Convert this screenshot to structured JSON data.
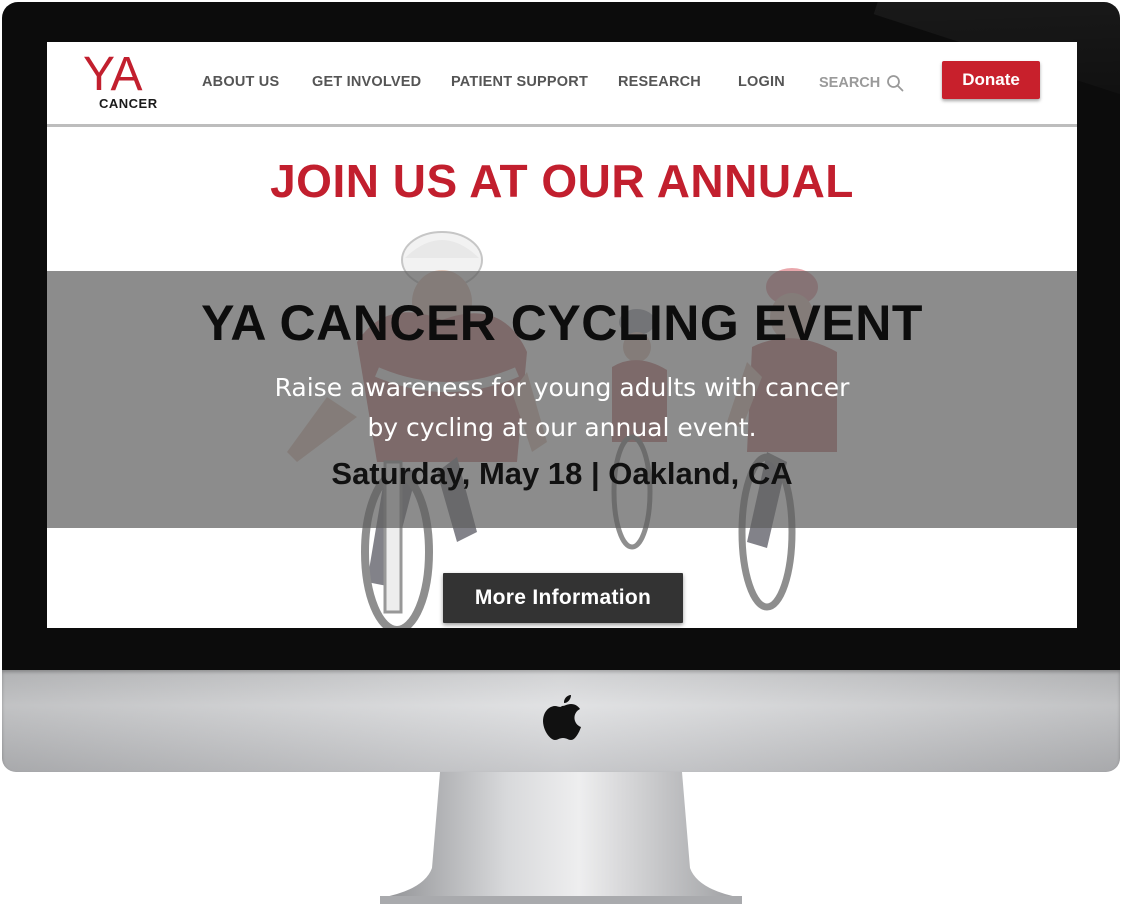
{
  "brand": {
    "logo_text": "YA",
    "logo_subtext": "CANCER",
    "accent_color": "#c21f2e"
  },
  "nav": {
    "items": [
      {
        "label": "ABOUT US"
      },
      {
        "label": "GET INVOLVED"
      },
      {
        "label": "PATIENT SUPPORT"
      },
      {
        "label": "RESEARCH"
      },
      {
        "label": "LOGIN"
      }
    ],
    "search_label": "SEARCH",
    "search_icon": "search-icon",
    "donate_label": "Donate"
  },
  "hero": {
    "heading": "JOIN US AT OUR ANNUAL",
    "event_title": "YA CANCER CYCLING EVENT",
    "description": "Raise awareness for young adults with cancer by cycling at our annual event.",
    "date_location": "Saturday, May 18 | Oakland, CA",
    "more_button_label": "More Information"
  },
  "device": {
    "logo_icon": "apple-logo-icon"
  }
}
